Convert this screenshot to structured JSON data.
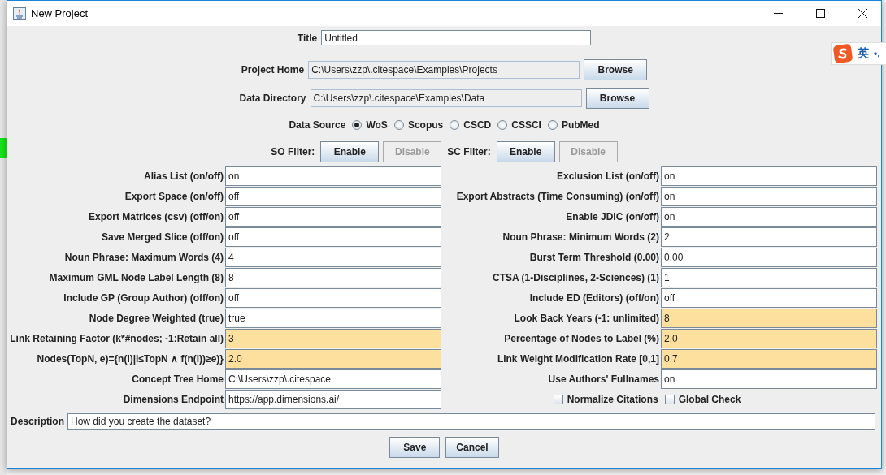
{
  "window": {
    "title": "New Project"
  },
  "title_field": {
    "label": "Title",
    "value": "Untitled"
  },
  "paths": [
    {
      "label": "Project Home",
      "value": "C:\\Users\\zzp\\.citespace\\Examples\\Projects",
      "button": "Browse"
    },
    {
      "label": "Data Directory",
      "value": "C:\\Users\\zzp\\.citespace\\Examples\\Data",
      "button": "Browse"
    }
  ],
  "data_source": {
    "label": "Data Source",
    "options": [
      {
        "label": "WoS",
        "selected": true
      },
      {
        "label": "Scopus",
        "selected": false
      },
      {
        "label": "CSCD",
        "selected": false
      },
      {
        "label": "CSSCI",
        "selected": false
      },
      {
        "label": "PubMed",
        "selected": false
      }
    ]
  },
  "filters": [
    {
      "label": "SO Filter:",
      "buttons": [
        {
          "label": "Enable",
          "disabled": false
        },
        {
          "label": "Disable",
          "disabled": true
        }
      ]
    },
    {
      "label": "SC Filter:",
      "buttons": [
        {
          "label": "Enable",
          "disabled": false
        },
        {
          "label": "Disable",
          "disabled": true
        }
      ]
    }
  ],
  "left_fields": [
    {
      "label": "Alias List (on/off)",
      "value": "on",
      "highlighted": false
    },
    {
      "label": "Export Space (on/off)",
      "value": "off",
      "highlighted": false
    },
    {
      "label": "Export Matrices (csv) (off/on)",
      "value": "off",
      "highlighted": false
    },
    {
      "label": "Save Merged Slice (off/on)",
      "value": "off",
      "highlighted": false
    },
    {
      "label": "Noun Phrase: Maximum Words (4)",
      "value": "4",
      "highlighted": false
    },
    {
      "label": "Maximum GML Node Label Length (8)",
      "value": "8",
      "highlighted": false
    },
    {
      "label": "Include GP (Group Author) (off/on)",
      "value": "off",
      "highlighted": false
    },
    {
      "label": "Node Degree Weighted (true)",
      "value": "true",
      "highlighted": false
    },
    {
      "label": "Link Retaining Factor (k*#nodes; -1:Retain all)",
      "value": "3",
      "highlighted": true
    },
    {
      "label": "Nodes(TopN, e)={n(i)|i≤TopN ∧ f(n(i))≥e)}",
      "value": "2.0",
      "highlighted": true
    },
    {
      "label": "Concept Tree Home",
      "value": "C:\\Users\\zzp\\.citespace",
      "highlighted": false
    },
    {
      "label": "Dimensions Endpoint",
      "value": "https://app.dimensions.ai/",
      "highlighted": false
    }
  ],
  "right_fields": [
    {
      "label": "Exclusion List (on/off)",
      "value": "on",
      "highlighted": false
    },
    {
      "label": "Export Abstracts (Time Consuming) (on/off)",
      "value": "on",
      "highlighted": false
    },
    {
      "label": "Enable JDIC (on/off)",
      "value": "on",
      "highlighted": false
    },
    {
      "label": "Noun Phrase: Minimum Words (2)",
      "value": "2",
      "highlighted": false
    },
    {
      "label": "Burst Term Threshold (0.00)",
      "value": "0.00",
      "highlighted": false
    },
    {
      "label": "CTSA (1-Disciplines, 2-Sciences) (1)",
      "value": "1",
      "highlighted": false
    },
    {
      "label": "Include ED (Editors) (off/on)",
      "value": "off",
      "highlighted": false
    },
    {
      "label": "Look Back Years (-1: unlimited)",
      "value": "8",
      "highlighted": true
    },
    {
      "label": "Percentage of Nodes to Label (%)",
      "value": "2.0",
      "highlighted": true
    },
    {
      "label": "Link Weight Modification Rate [0,1]",
      "value": "0.7",
      "highlighted": true
    },
    {
      "label": "Use Authors' Fullnames",
      "value": "on",
      "highlighted": false
    }
  ],
  "checkboxes": [
    {
      "label": "Normalize Citations",
      "checked": false
    },
    {
      "label": "Global Check",
      "checked": false
    }
  ],
  "description": {
    "label": "Description",
    "value": "How did you create the dataset?"
  },
  "buttons": [
    "Save",
    "Cancel"
  ],
  "ime": {
    "text": "英",
    "punct": "•,"
  }
}
